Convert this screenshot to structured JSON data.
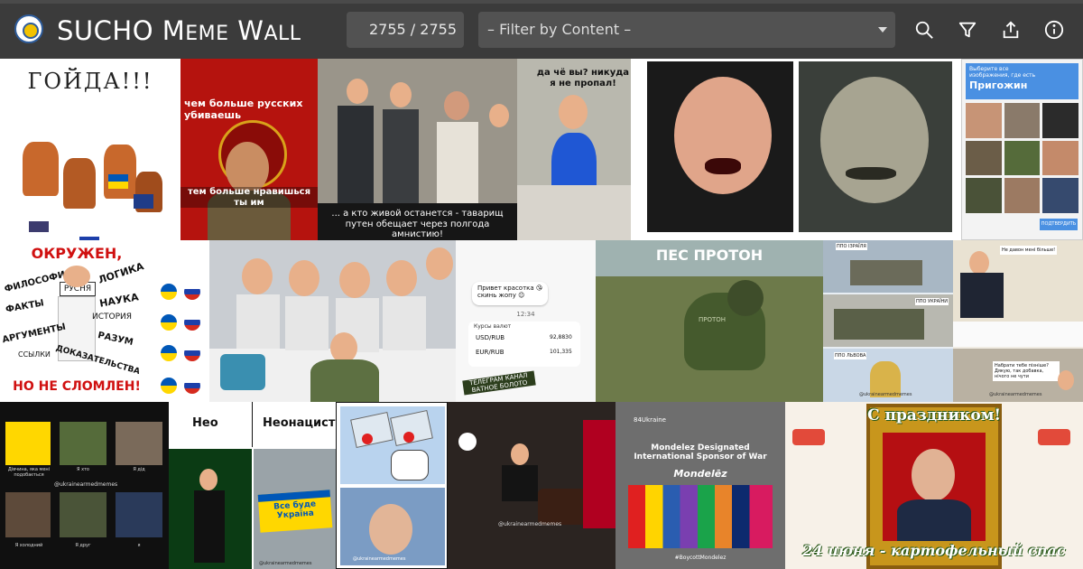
{
  "header": {
    "title_lead": "SUCHO M",
    "title_word1_rest": "EME",
    "title_space": " W",
    "title_word2_rest": "ALL",
    "counter": "2755 / 2755",
    "filter_label": "– Filter by Content –"
  },
  "icons": [
    "search-icon",
    "filter-icon",
    "share-icon",
    "info-icon"
  ],
  "memes": [
    {
      "id": "m1",
      "text": "ГОЙДА!!!"
    },
    {
      "id": "m2",
      "top": "чем больше русских убиваешь",
      "bottom": "тем больше нравишься ты им"
    },
    {
      "id": "m3",
      "text": "... а кто живой останется - таварищ путен обещает через полгода амнистию!"
    },
    {
      "id": "m4",
      "text": "да чё вы? никуда я не пропал!"
    },
    {
      "id": "m6",
      "title": "Выберите все изображения, где есть",
      "target": "Пригожин",
      "button": "ПОДТВЕРДИТЬ"
    },
    {
      "id": "m7",
      "lines": [
        "ОКРУЖЕН,",
        "ЛОГИКА",
        "ФИЛОСОФИЯ",
        "РУСНЯ",
        "ФАКТЫ",
        "НАУКА",
        "ИСТОРИЯ",
        "АРГУМЕНТЫ",
        "РАЗУМ",
        "ССЫЛКИ",
        "ДОКАЗАТЕЛЬСТВА",
        "НО НЕ СЛОМЛЕН!"
      ]
    },
    {
      "id": "m10",
      "greeting": "Привет красотка 😘 скинь жопу 😉",
      "time": "12:34",
      "label": "Курсы валют",
      "r1": "USD/RUB",
      "v1": "92,8830",
      "r2": "EUR/RUB",
      "v2": "101,335",
      "stamp": "ТЕЛЕГРАМ КАНАЛ ВАТНОЕ БОЛОТО"
    },
    {
      "id": "m11",
      "title": "ПЕС ПРОТОН",
      "tag": "ПРОТОН"
    },
    {
      "id": "m12",
      "l1": "ППО ІЗРАЇЛЯ",
      "l2": "ППО УКРАЇНИ",
      "l3": "ППО ЛЬВОВА",
      "wm": "@ukrainearmedmemes"
    },
    {
      "id": "m13",
      "top": "Не давон мені більше!",
      "bottom": "Набрати тебе пізніше? Дякую, так добавка, нічого не чути",
      "wm": "@ukrainearmedmemes"
    },
    {
      "id": "m14",
      "c1": "Дівчина, яка мені подобається",
      "c2": "Я хто",
      "c3": "Я дід",
      "c4": "Я холодний",
      "c5": "Я друг",
      "c6": "я",
      "wm": "@ukrainearmedmemes"
    },
    {
      "id": "m15",
      "left": "Нео",
      "right": "Неонацист",
      "banner": "Все буде Україна",
      "wm": "@ukrainearmedmemes"
    },
    {
      "id": "m16",
      "wm": "@ukrainearmedmemes"
    },
    {
      "id": "m17",
      "wm": "@ukrainearmedmemes"
    },
    {
      "id": "m18",
      "tag": "84Ukraine",
      "title": "Mondelez Designated International Sponsor of War",
      "brand": "Mondelēz",
      "footer": "#BoycottMondelez"
    },
    {
      "id": "m19",
      "top": "С праздником!",
      "bottom": "24 июня - картофельный спас"
    }
  ]
}
